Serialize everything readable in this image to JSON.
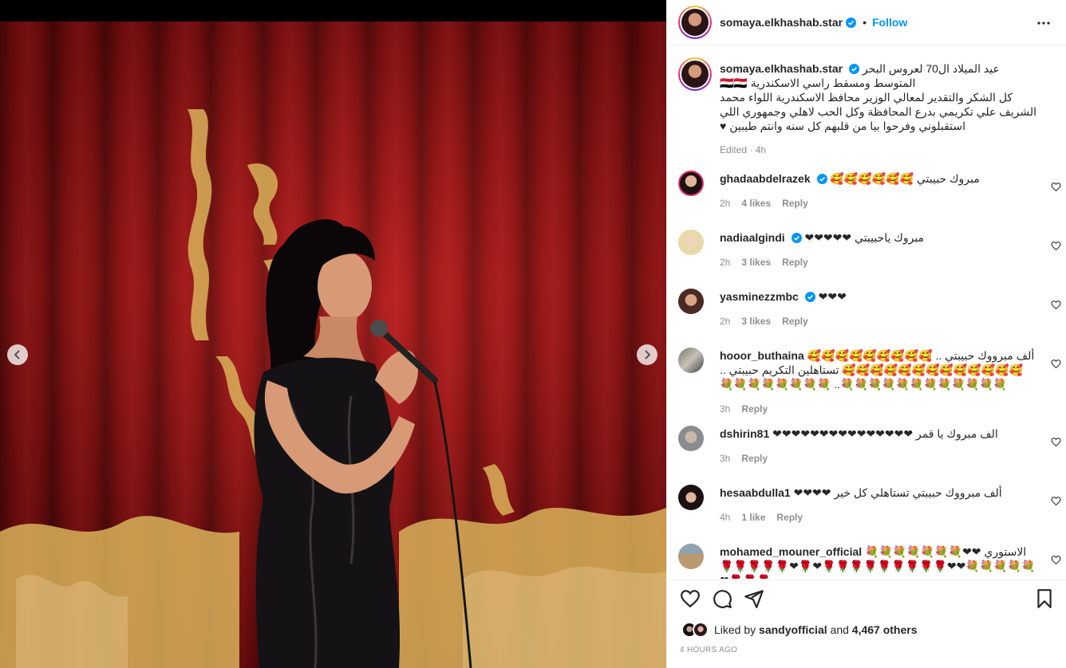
{
  "post": {
    "username": "somaya.elkhashab.star",
    "follow_label": "Follow",
    "dot": "•",
    "caption_lines": [
      "عيد الميلاد ال70 لعروس البحر المتوسط ومسقط راسي الاسكندرية 🇪🇬🇪🇬",
      "كل الشكر والتقدير لمعالي الوزير محافظ الاسكندرية اللواء محمد الشريف علي تكريمي بدرع المحافظة وكل الحب لاهلي وجمهوري اللي استقبلوني وفرحوا بيا من قلبهم كل سنه وانتم طيبين ♥"
    ],
    "caption_meta": "Edited · 4h"
  },
  "comments": [
    {
      "username": "ghadaabdelrazek",
      "verified": true,
      "text": "مبروك حبيبتي 🥰🥰🥰🥰🥰🥰",
      "time": "2h",
      "likes": "4 likes",
      "reply": "Reply"
    },
    {
      "username": "nadiaalgindi",
      "verified": true,
      "text": "مبروك ياحبيبتي ❤❤❤❤❤",
      "time": "2h",
      "likes": "3 likes",
      "reply": "Reply"
    },
    {
      "username": "yasminezzmbc",
      "verified": true,
      "text": "❤❤❤",
      "time": "2h",
      "likes": "3 likes",
      "reply": "Reply"
    },
    {
      "username": "hooor_buthaina",
      "verified": false,
      "text": "ألف مبرووك حبيبتي .. 🥰🥰🥰🥰🥰🥰🥰🥰🥰🥰🥰🥰🥰🥰🥰🥰🥰🥰🥰🥰🥰🥰 تستاهلين التكريم حبيبتي .. 💐💐💐💐💐💐💐💐💐💐💐💐.. 💐💐💐💐💐💐💐💐",
      "time": "3h",
      "likes": "",
      "reply": "Reply"
    },
    {
      "username": "dshirin81",
      "verified": false,
      "text": "الف مبروك يا قمر ❤❤❤❤❤❤❤❤❤❤❤❤❤❤❤",
      "time": "3h",
      "likes": "",
      "reply": "Reply"
    },
    {
      "username": "hesaabdulla1",
      "verified": false,
      "text": "ألف مبرووك حبيبتي تستاهلي كل خير ❤❤❤❤",
      "time": "4h",
      "likes": "1 like",
      "reply": "Reply"
    },
    {
      "username": "mohamed_mouner_official",
      "verified": false,
      "text": "الاستوري ❤❤💐💐💐💐💐💐💐💐💐💐💐💐❤❤🌹🌹🌹🌹🌹🌹🌹🌹🌹❤🌹❤🌹🌹🌹🌹🌹🌹🌹🌹❤",
      "time": "",
      "likes": "",
      "reply": ""
    }
  ],
  "footer": {
    "liked_by_prefix": "Liked by",
    "liked_by_user": "sandyofficial",
    "liked_by_and": "and",
    "liked_by_count": "4,467 others",
    "timestamp": "4 HOURS AGO"
  },
  "colors": {
    "accent": "#0095f6",
    "curtain": "#a31517",
    "gold": "#d9b25a"
  },
  "icons": [
    "heart-icon",
    "comment-icon",
    "share-icon",
    "bookmark-icon",
    "more-icon",
    "verified-icon",
    "chevron-left-icon",
    "chevron-right-icon"
  ]
}
